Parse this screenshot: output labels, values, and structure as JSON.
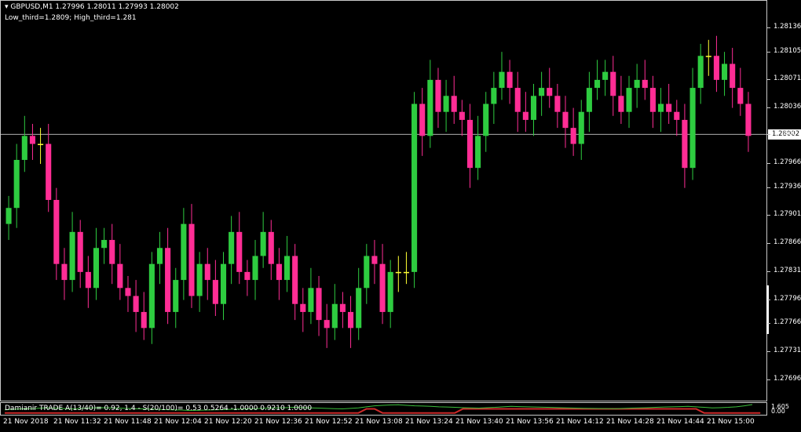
{
  "header": {
    "symbol_line": "GBPUSD,M1  1.27996 1.28011 1.27993 1.28002",
    "thirds_line": "Low_third=1.2809; High_third=1.281"
  },
  "indicator": {
    "label": "Damianir TRADE  A(13/40)= 0.92, 1.4 - S(20/100)= 0.53  0.5264 -1.0000 0.9210 1.0000",
    "value_top": "1.605",
    "value_bottom": "0.00"
  },
  "current_price_label": "1.28002",
  "colors": {
    "bull": "#2ecc40",
    "bear": "#ff2d95",
    "doji": "#ffff33",
    "price_line": "#c8c8c8",
    "ind_green": "#3cbf3c",
    "ind_red": "#cc2a2a"
  },
  "chart_data": {
    "type": "candlestick",
    "symbol": "GBPUSD",
    "timeframe": "M1",
    "y_ticks": [
      "1.28136",
      "1.28105",
      "1.28071",
      "1.28036",
      "1.28002",
      "1.27966",
      "1.27936",
      "1.27901",
      "1.27866",
      "1.27831",
      "1.27796",
      "1.27766",
      "1.27731",
      "1.27696"
    ],
    "x_ticks": [
      "21 Nov 2018",
      "21 Nov 11:32",
      "21 Nov 11:48",
      "21 Nov 12:04",
      "21 Nov 12:20",
      "21 Nov 12:36",
      "21 Nov 12:52",
      "21 Nov 13:08",
      "21 Nov 13:24",
      "21 Nov 13:40",
      "21 Nov 13:56",
      "21 Nov 14:12",
      "21 Nov 14:28",
      "21 Nov 14:44",
      "21 Nov 15:00"
    ],
    "ylim": [
      1.2768,
      1.2816
    ],
    "current_price": 1.28002,
    "closes": [
      1.2791,
      1.2797,
      1.28,
      1.2799,
      1.2799,
      1.2792,
      1.2784,
      1.2782,
      1.2788,
      1.2783,
      1.2781,
      1.2786,
      1.2787,
      1.2784,
      1.2781,
      1.278,
      1.2778,
      1.2776,
      1.2784,
      1.2786,
      1.2778,
      1.2782,
      1.2789,
      1.278,
      1.2784,
      1.2782,
      1.2779,
      1.2784,
      1.2788,
      1.2783,
      1.2782,
      1.2785,
      1.2788,
      1.2784,
      1.2782,
      1.2785,
      1.2779,
      1.2778,
      1.2781,
      1.2777,
      1.2776,
      1.2779,
      1.2778,
      1.2776,
      1.2781,
      1.2785,
      1.2784,
      1.2778,
      1.2783,
      1.2783,
      1.2783,
      1.2804,
      1.28,
      1.2807,
      1.2803,
      1.2805,
      1.2803,
      1.2802,
      1.2796,
      1.28,
      1.2804,
      1.2806,
      1.2808,
      1.2806,
      1.2803,
      1.2802,
      1.2805,
      1.2806,
      1.2805,
      1.2803,
      1.2801,
      1.2799,
      1.2803,
      1.2806,
      1.2807,
      1.2808,
      1.2805,
      1.2803,
      1.2806,
      1.2807,
      1.2806,
      1.2803,
      1.2804,
      1.2803,
      1.2802,
      1.2796,
      1.2806,
      1.281,
      1.281,
      1.2807,
      1.2809,
      1.2806,
      1.2804,
      1.28
    ]
  },
  "indicator_data": {
    "fast": [
      0.4,
      0.45,
      0.5,
      0.52,
      0.55,
      0.6,
      0.58,
      0.55,
      0.5,
      0.52,
      0.56,
      0.6,
      0.62,
      0.6,
      0.58,
      0.55,
      0.52,
      0.5,
      0.48,
      0.45,
      0.42,
      0.4,
      0.38,
      0.35,
      0.36,
      0.38,
      0.4,
      0.42,
      0.45,
      0.48,
      0.5,
      0.52,
      0.55,
      0.58,
      0.6,
      0.62,
      0.65,
      0.62,
      0.6,
      0.58,
      0.55,
      0.52,
      0.5,
      0.55,
      0.6,
      0.7,
      0.8,
      0.85,
      0.88,
      0.9,
      0.85,
      0.8,
      0.78,
      0.75,
      0.7,
      0.68,
      0.65,
      0.62,
      0.6,
      0.58,
      0.62,
      0.65,
      0.7,
      0.75,
      0.72,
      0.7,
      0.68,
      0.66,
      0.64,
      0.62,
      0.6,
      0.58,
      0.56,
      0.55,
      0.54,
      0.53,
      0.52,
      0.55,
      0.58,
      0.6,
      0.62,
      0.65,
      0.68,
      0.7,
      0.72,
      0.75,
      0.7,
      0.65,
      0.6,
      0.62,
      0.65,
      0.7,
      0.8,
      0.92
    ],
    "slow": [
      0.1,
      0.1,
      0.1,
      0.1,
      0.1,
      0.1,
      0.1,
      0.1,
      0.1,
      0.1,
      0.1,
      0.1,
      0.1,
      0.1,
      0.1,
      0.1,
      0.1,
      0.1,
      0.1,
      0.1,
      0.1,
      0.1,
      0.1,
      0.1,
      0.1,
      0.1,
      0.1,
      0.1,
      0.1,
      0.1,
      0.1,
      0.1,
      0.1,
      0.1,
      0.1,
      0.1,
      0.1,
      0.1,
      0.1,
      0.1,
      0.1,
      0.1,
      0.1,
      0.1,
      0.1,
      0.5,
      0.5,
      0.1,
      0.1,
      0.1,
      0.1,
      0.1,
      0.1,
      0.1,
      0.1,
      0.1,
      0.1,
      0.5,
      0.5,
      0.5,
      0.5,
      0.5,
      0.5,
      0.5,
      0.5,
      0.5,
      0.5,
      0.5,
      0.5,
      0.5,
      0.5,
      0.5,
      0.5,
      0.5,
      0.5,
      0.5,
      0.5,
      0.5,
      0.5,
      0.5,
      0.5,
      0.5,
      0.5,
      0.5,
      0.5,
      0.5,
      0.5,
      0.1,
      0.1,
      0.1,
      0.1,
      0.1,
      0.1,
      0.1,
      0.1
    ]
  }
}
